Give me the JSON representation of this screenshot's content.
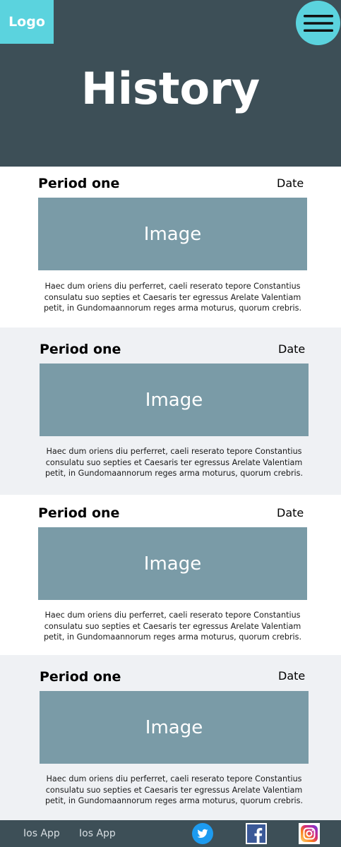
{
  "header": {
    "logo": "Logo",
    "title": "History",
    "menu_icon": "hamburger-icon"
  },
  "sections": [
    {
      "period": "Period one",
      "date": "Date",
      "image": "Image",
      "text": "Haec dum oriens diu perferret, caeli reserato tepore Constantius consulatu suo septies et Caesaris ter egressus Arelate Valentiam petit, in Gundomaannorum reges arma moturus, quorum crebris."
    },
    {
      "period": "Period one",
      "date": "Date",
      "image": "Image",
      "text": "Haec dum oriens diu perferret, caeli reserato tepore Constantius consulatu suo septies et Caesaris ter egressus Arelate Valentiam petit, in Gundomaannorum reges arma moturus, quorum crebris."
    },
    {
      "period": "Period one",
      "date": "Date",
      "image": "Image",
      "text": "Haec dum oriens diu perferret, caeli reserato tepore Constantius consulatu suo septies et Caesaris ter egressus Arelate Valentiam petit, in Gundomaannorum reges arma moturus, quorum crebris."
    },
    {
      "period": "Period one",
      "date": "Date",
      "image": "Image",
      "text": "Haec dum oriens diu perferret, caeli reserato tepore Constantius consulatu suo septies et Caesaris ter egressus Arelate Valentiam petit, in Gundomaannorum reges arma moturus, quorum crebris."
    }
  ],
  "footer": {
    "links": [
      "Ios App",
      "Ios App"
    ],
    "social": [
      "twitter-icon",
      "facebook-icon",
      "instagram-icon"
    ]
  },
  "colors": {
    "header_bg": "#3d4f57",
    "accent": "#5bd3de",
    "image_placeholder": "#7a9ba7",
    "alt_section_bg": "#eff1f4"
  }
}
